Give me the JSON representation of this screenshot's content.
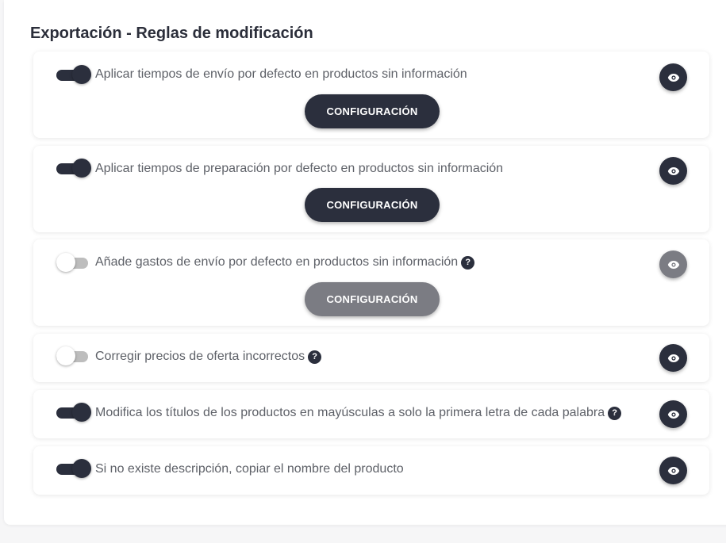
{
  "section": {
    "title": "Exportación - Reglas de modificación"
  },
  "rules": [
    {
      "label": "Aplicar tiempos de envío por defecto en productos sin información",
      "enabled": true,
      "has_help": false,
      "config_label": "CONFIGURACIÓN"
    },
    {
      "label": "Aplicar tiempos de preparación por defecto en productos sin información",
      "enabled": true,
      "has_help": false,
      "config_label": "CONFIGURACIÓN"
    },
    {
      "label": "Añade gastos de envío por defecto en productos sin información",
      "enabled": false,
      "has_help": true,
      "help_symbol": "?",
      "config_label": "CONFIGURACIÓN"
    },
    {
      "label": "Corregir precios de oferta incorrectos",
      "enabled": false,
      "has_help": true,
      "help_symbol": "?"
    },
    {
      "label": "Modifica los títulos de los productos en mayúsculas a solo la primera letra de cada palabra",
      "enabled": true,
      "has_help": true,
      "help_symbol": "?"
    },
    {
      "label": "Si no existe descripción, copiar el nombre del producto",
      "enabled": true,
      "has_help": false
    }
  ],
  "icons": {
    "preview": "eye-icon",
    "help": "question-icon"
  },
  "colors": {
    "primary": "#2b2f3d",
    "disabled": "#7b7c83",
    "text": "#5e6168",
    "title": "#2b2e3a"
  }
}
